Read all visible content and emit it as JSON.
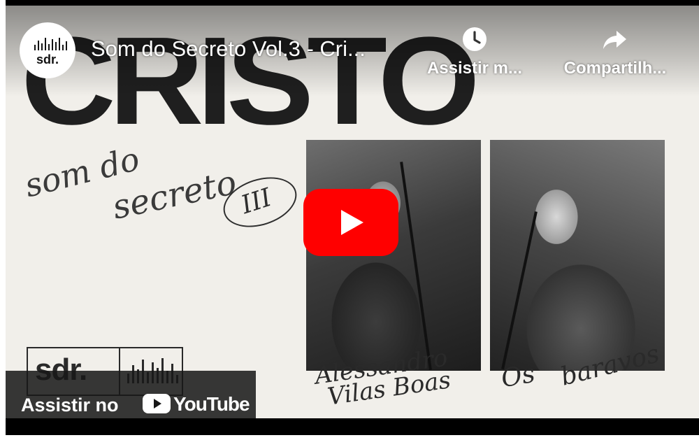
{
  "video": {
    "title": "Som do Secreto Vol.3 - Cri...",
    "channel_avatar_text": "sdr."
  },
  "top_actions": {
    "watch_later": "Assistir m...",
    "share": "Compartilh..."
  },
  "watch_on": {
    "label": "Assistir no",
    "brand": "YouTube"
  },
  "artwork": {
    "headline": "CRISTO",
    "script_line1": "som do",
    "script_line2": "secreto",
    "volume_mark": "III",
    "logo_text": "sdr.",
    "signature_1a": "Alessandro",
    "signature_1b": "Vilas Boas",
    "signature_2a": "Os",
    "signature_2b": "baravos"
  },
  "icons": {
    "watch_later": "clock-icon",
    "share": "share-arrow-icon",
    "play": "play-icon",
    "youtube": "youtube-logo-icon"
  },
  "colors": {
    "play_button": "#ff0000",
    "overlay_bar": "#171717",
    "artwork_bg": "#f1efea"
  }
}
